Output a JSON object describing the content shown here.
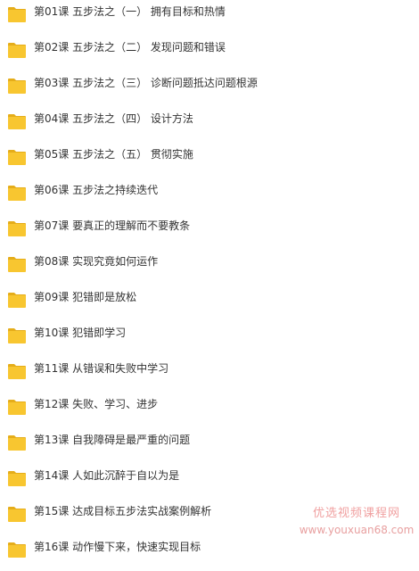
{
  "folders": [
    {
      "label": "第01课 五步法之（一） 拥有目标和热情"
    },
    {
      "label": "第02课 五步法之（二） 发现问题和错误"
    },
    {
      "label": "第03课 五步法之（三） 诊断问题抵达问题根源"
    },
    {
      "label": "第04课 五步法之（四） 设计方法"
    },
    {
      "label": "第05课 五步法之（五） 贯彻实施"
    },
    {
      "label": "第06课 五步法之持续迭代"
    },
    {
      "label": "第07课 要真正的理解而不要教条"
    },
    {
      "label": "第08课 实现究竟如何运作"
    },
    {
      "label": "第09课 犯错即是放松"
    },
    {
      "label": "第10课 犯错即学习"
    },
    {
      "label": "第11课 从错误和失败中学习"
    },
    {
      "label": "第12课 失败、学习、进步"
    },
    {
      "label": "第13课 自我障碍是最严重的问题"
    },
    {
      "label": "第14课 人如此沉醉于自以为是"
    },
    {
      "label": "第15课 达成目标五步法实战案例解析"
    },
    {
      "label": "第16课 动作慢下来，快速实现目标"
    }
  ],
  "folder_icon": "folder-icon",
  "colors": {
    "folder_fill": "#f8c630",
    "folder_dark": "#e5ad1a",
    "label_text": "#333333",
    "watermark_cn": "#f0a0a0",
    "watermark_url": "#e8a0a0"
  },
  "watermark": {
    "text_cn": "优选视频课程网",
    "url": "www.youxuan68.com"
  }
}
